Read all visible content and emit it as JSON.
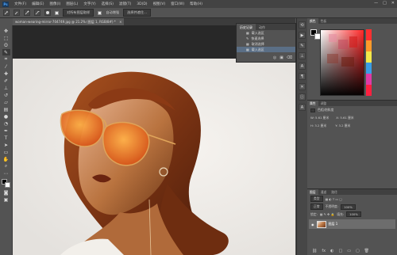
{
  "menubar": {
    "logo": "Ps",
    "items": [
      "文件(F)",
      "编辑(E)",
      "图像(I)",
      "图层(L)",
      "文字(Y)",
      "选择(S)",
      "滤镜(T)",
      "3D(D)",
      "视图(V)",
      "窗口(W)",
      "帮助(H)"
    ],
    "controls": [
      "—",
      "□",
      "✕"
    ]
  },
  "options_bar": {
    "field1": "对所有图层取样",
    "check_label": "自动增强",
    "button": "选择并遮住..."
  },
  "document": {
    "tab_title": "woman-wearing-mirror-704749.jpg @ 21.2% (图层 1, RGB/8#) *",
    "close": "×"
  },
  "history": {
    "tabs": [
      "历史记录",
      "动作"
    ],
    "items": [
      "载入选区",
      "快速选择",
      "取消选择",
      "载入选区"
    ],
    "selected_index": 3
  },
  "color_panel": {
    "tabs": [
      "颜色",
      "色板"
    ]
  },
  "adjustments": {
    "tabs": [
      "属性",
      "调整"
    ],
    "header": "色相/饱和度",
    "rows": [
      "W:  5.61 厘米",
      "X:  5.61 厘米",
      "H:  3.2 厘米",
      "Y:  3.2 厘米"
    ]
  },
  "layers": {
    "tabs": [
      "图层",
      "通道",
      "路径"
    ],
    "kind_label": "类型",
    "blend_mode": "正常",
    "opacity_label": "不透明度:",
    "opacity_value": "100%",
    "lock_label": "锁定:",
    "fill_label": "填充:",
    "fill_value": "100%",
    "layer_name": "图层 1",
    "footer_icons": [
      "fx",
      "◐",
      "□",
      "▭",
      "▢",
      "🗑"
    ]
  },
  "colors": {
    "app_bg": "#535353",
    "panel_dark": "#3c3c3c",
    "selection_blue": "#5b6f86",
    "accent_hair": "#8b3a15"
  }
}
